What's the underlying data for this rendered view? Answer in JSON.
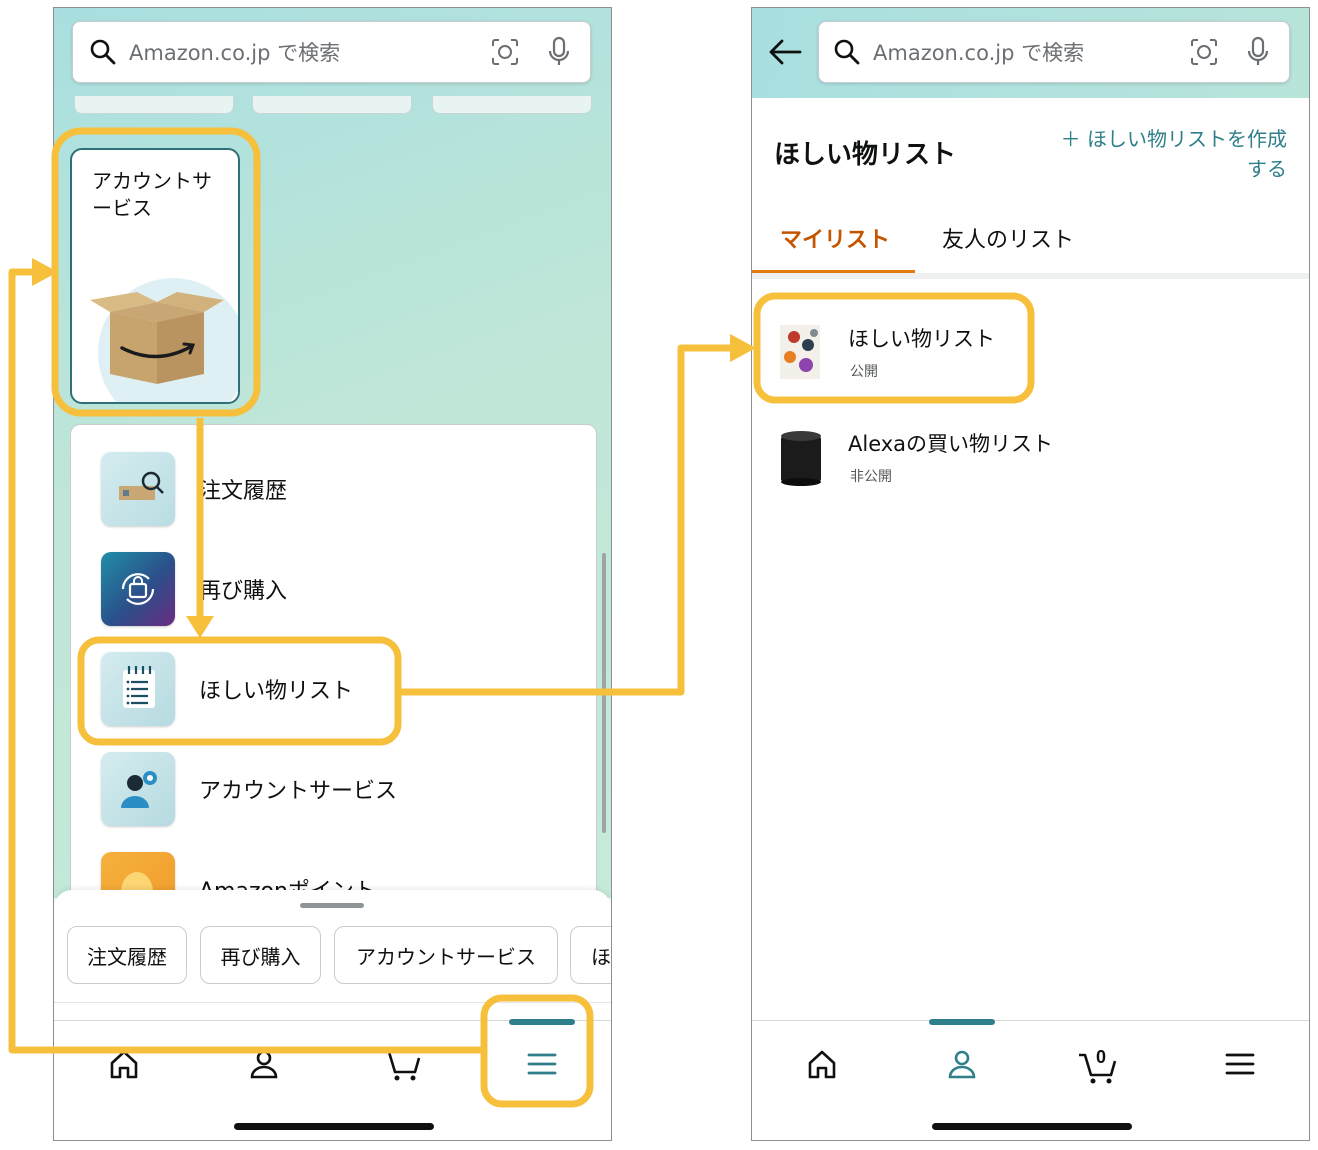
{
  "left_screen": {
    "search": {
      "placeholder": "Amazon.co.jp で検索"
    },
    "account_card": {
      "title": "アカウントサービス"
    },
    "menu_items": [
      {
        "label": "注文履歴",
        "icon": "order-history-icon"
      },
      {
        "label": "再び購入",
        "icon": "buy-again-icon"
      },
      {
        "label": "ほしい物リスト",
        "icon": "wishlist-icon"
      },
      {
        "label": "アカウントサービス",
        "icon": "account-service-icon"
      },
      {
        "label": "Amazonポイント",
        "icon": "points-icon"
      }
    ],
    "chips": [
      "注文履歴",
      "再び購入",
      "アカウントサービス",
      "ほ"
    ],
    "nav": [
      "home",
      "account",
      "cart",
      "menu"
    ]
  },
  "right_screen": {
    "search": {
      "placeholder": "Amazon.co.jp で検索"
    },
    "page_title": "ほしい物リスト",
    "create_link": "＋ ほしい物リストを作成する",
    "tabs": [
      {
        "label": "マイリスト",
        "active": true
      },
      {
        "label": "友人のリスト",
        "active": false
      }
    ],
    "lists": [
      {
        "name": "ほしい物リスト",
        "status": "公開"
      },
      {
        "name": "Alexaの買い物リスト",
        "status": "非公開"
      }
    ],
    "cart_count": "0",
    "nav": [
      "home",
      "account",
      "cart",
      "menu"
    ]
  },
  "colors": {
    "highlight": "#f6c03c",
    "teal": "#2f7f8a",
    "active_tab": "#c45500"
  }
}
